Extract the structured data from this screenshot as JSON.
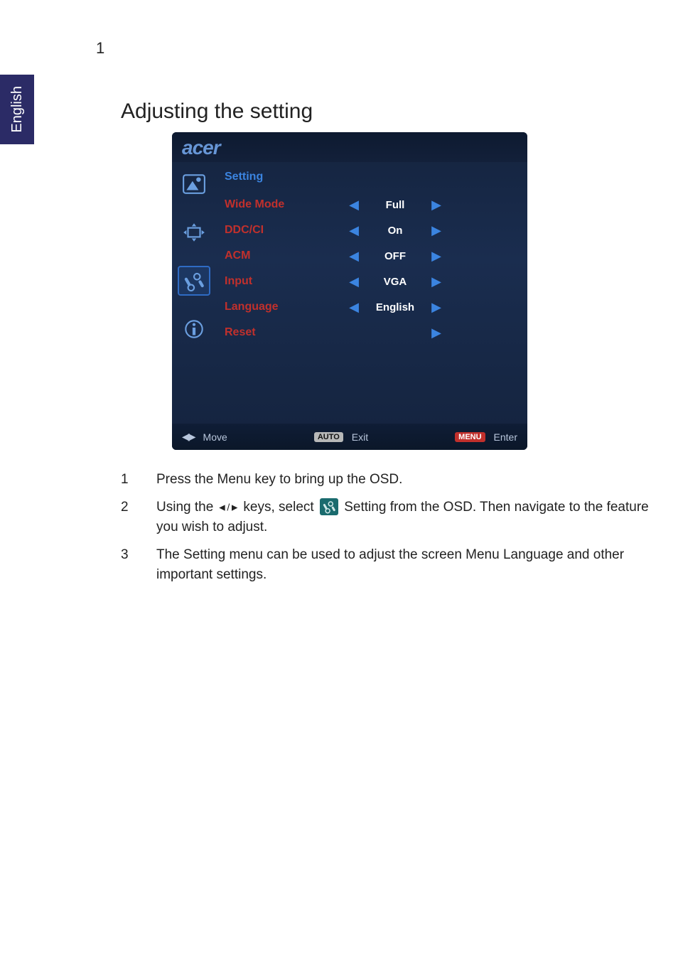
{
  "page": {
    "number": "1",
    "side_label": "English"
  },
  "section": {
    "title": "Adjusting the setting"
  },
  "osd": {
    "brand": "acer",
    "menu_title": "Setting",
    "rows": [
      {
        "label": "Wide Mode",
        "value": "Full",
        "has_left": true,
        "has_right": true
      },
      {
        "label": "DDC/CI",
        "value": "On",
        "has_left": true,
        "has_right": true
      },
      {
        "label": "ACM",
        "value": "OFF",
        "has_left": true,
        "has_right": true
      },
      {
        "label": "Input",
        "value": "VGA",
        "has_left": true,
        "has_right": true
      },
      {
        "label": "Language",
        "value": "English",
        "has_left": true,
        "has_right": true
      },
      {
        "label": "Reset",
        "value": "",
        "has_left": false,
        "has_right": true
      }
    ],
    "footer": {
      "move": "Move",
      "auto_tag": "AUTO",
      "exit": "Exit",
      "menu_tag": "MENU",
      "enter": "Enter"
    }
  },
  "steps": {
    "s1_num": "1",
    "s1_text": "Press the Menu key to bring up the OSD.",
    "s2_num": "2",
    "s2_pre": "Using the ",
    "s2_keys": "◄/►",
    "s2_mid": " keys, select ",
    "s2_post": " Setting from the OSD. Then navigate to the feature you wish to adjust.",
    "s3_num": "3",
    "s3_text": "The Setting menu can be used to adjust the screen Menu Language and other important settings."
  }
}
